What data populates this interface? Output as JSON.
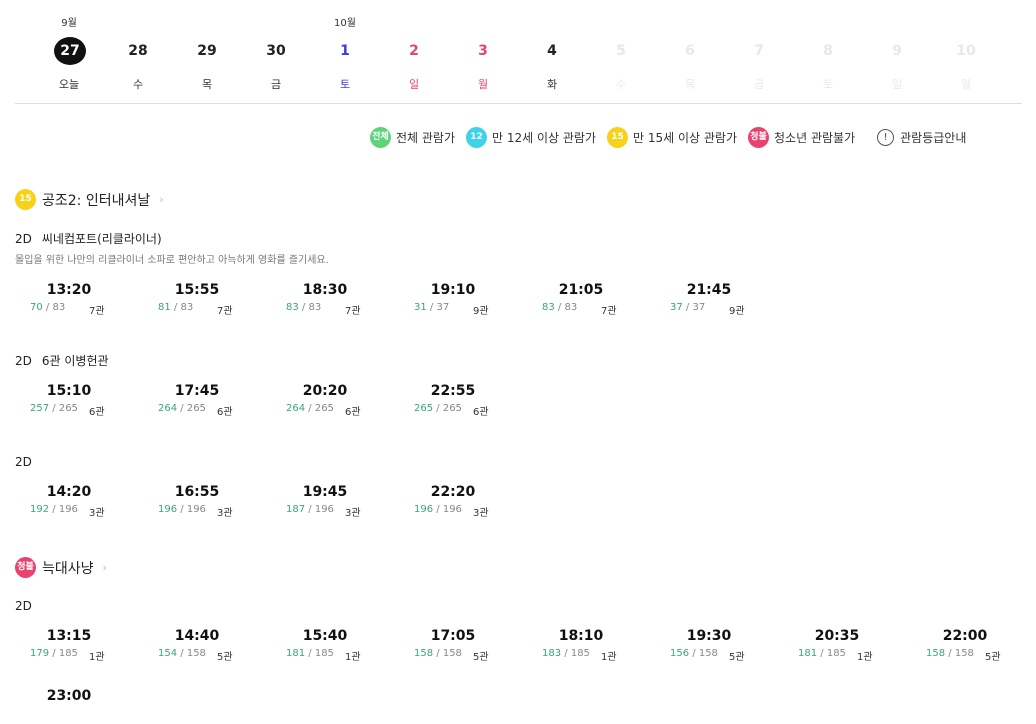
{
  "dates": [
    {
      "month": "9월",
      "num": "27",
      "weekday": "오늘",
      "type": "selected"
    },
    {
      "num": "28",
      "weekday": "수",
      "type": "normal"
    },
    {
      "num": "29",
      "weekday": "목",
      "type": "normal"
    },
    {
      "num": "30",
      "weekday": "금",
      "type": "normal"
    },
    {
      "month": "10월",
      "num": "1",
      "weekday": "토",
      "type": "sat"
    },
    {
      "num": "2",
      "weekday": "일",
      "type": "sun"
    },
    {
      "num": "3",
      "weekday": "월",
      "type": "sun"
    },
    {
      "num": "4",
      "weekday": "화",
      "type": "normal"
    },
    {
      "num": "5",
      "weekday": "수",
      "type": "disabled"
    },
    {
      "num": "6",
      "weekday": "목",
      "type": "disabled"
    },
    {
      "num": "7",
      "weekday": "금",
      "type": "disabled"
    },
    {
      "num": "8",
      "weekday": "토",
      "type": "disabled"
    },
    {
      "num": "9",
      "weekday": "일",
      "type": "disabled"
    },
    {
      "num": "10",
      "weekday": "월",
      "type": "disabled"
    }
  ],
  "legend": {
    "all": {
      "badge": "전체",
      "label": "전체 관람가"
    },
    "age12": {
      "badge": "12",
      "label": "만 12세 이상 관람가"
    },
    "age15": {
      "badge": "15",
      "label": "만 15세 이상 관람가"
    },
    "adult": {
      "badge": "청불",
      "label": "청소년 관람불가"
    },
    "guide": {
      "icon": "!",
      "label": "관람등급안내"
    }
  },
  "movies": [
    {
      "title": "공조2: 인터내셔날",
      "rating_badge": "15",
      "halls": [
        {
          "format": "2D",
          "name": "씨네컴포트(리클라이너)",
          "desc": "몰입을 위한 나만의 리클라이너 소파로 편안하고 아늑하게 영화를 즐기세요.",
          "slots": [
            {
              "time": "13:20",
              "remain": "70",
              "total": "83",
              "room": "7관"
            },
            {
              "time": "15:55",
              "remain": "81",
              "total": "83",
              "room": "7관"
            },
            {
              "time": "18:30",
              "remain": "83",
              "total": "83",
              "room": "7관"
            },
            {
              "time": "19:10",
              "remain": "31",
              "total": "37",
              "room": "9관"
            },
            {
              "time": "21:05",
              "remain": "83",
              "total": "83",
              "room": "7관"
            },
            {
              "time": "21:45",
              "remain": "37",
              "total": "37",
              "room": "9관"
            }
          ]
        },
        {
          "format": "2D",
          "name": "6관 이병헌관",
          "slots": [
            {
              "time": "15:10",
              "remain": "257",
              "total": "265",
              "room": "6관"
            },
            {
              "time": "17:45",
              "remain": "264",
              "total": "265",
              "room": "6관"
            },
            {
              "time": "20:20",
              "remain": "264",
              "total": "265",
              "room": "6관"
            },
            {
              "time": "22:55",
              "remain": "265",
              "total": "265",
              "room": "6관"
            }
          ]
        },
        {
          "format": "2D",
          "name": "",
          "slots": [
            {
              "time": "14:20",
              "remain": "192",
              "total": "196",
              "room": "3관"
            },
            {
              "time": "16:55",
              "remain": "196",
              "total": "196",
              "room": "3관"
            },
            {
              "time": "19:45",
              "remain": "187",
              "total": "196",
              "room": "3관"
            },
            {
              "time": "22:20",
              "remain": "196",
              "total": "196",
              "room": "3관"
            }
          ]
        }
      ]
    },
    {
      "title": "늑대사냥",
      "rating_badge": "청불",
      "halls": [
        {
          "format": "2D",
          "name": "",
          "slots": [
            {
              "time": "13:15",
              "remain": "179",
              "total": "185",
              "room": "1관"
            },
            {
              "time": "14:40",
              "remain": "154",
              "total": "158",
              "room": "5관"
            },
            {
              "time": "15:40",
              "remain": "181",
              "total": "185",
              "room": "1관"
            },
            {
              "time": "17:05",
              "remain": "158",
              "total": "158",
              "room": "5관"
            },
            {
              "time": "18:10",
              "remain": "183",
              "total": "185",
              "room": "1관"
            },
            {
              "time": "19:30",
              "remain": "156",
              "total": "158",
              "room": "5관"
            },
            {
              "time": "20:35",
              "remain": "181",
              "total": "185",
              "room": "1관"
            },
            {
              "time": "22:00",
              "remain": "158",
              "total": "158",
              "room": "5관"
            },
            {
              "time": "23:00"
            }
          ]
        }
      ]
    }
  ]
}
